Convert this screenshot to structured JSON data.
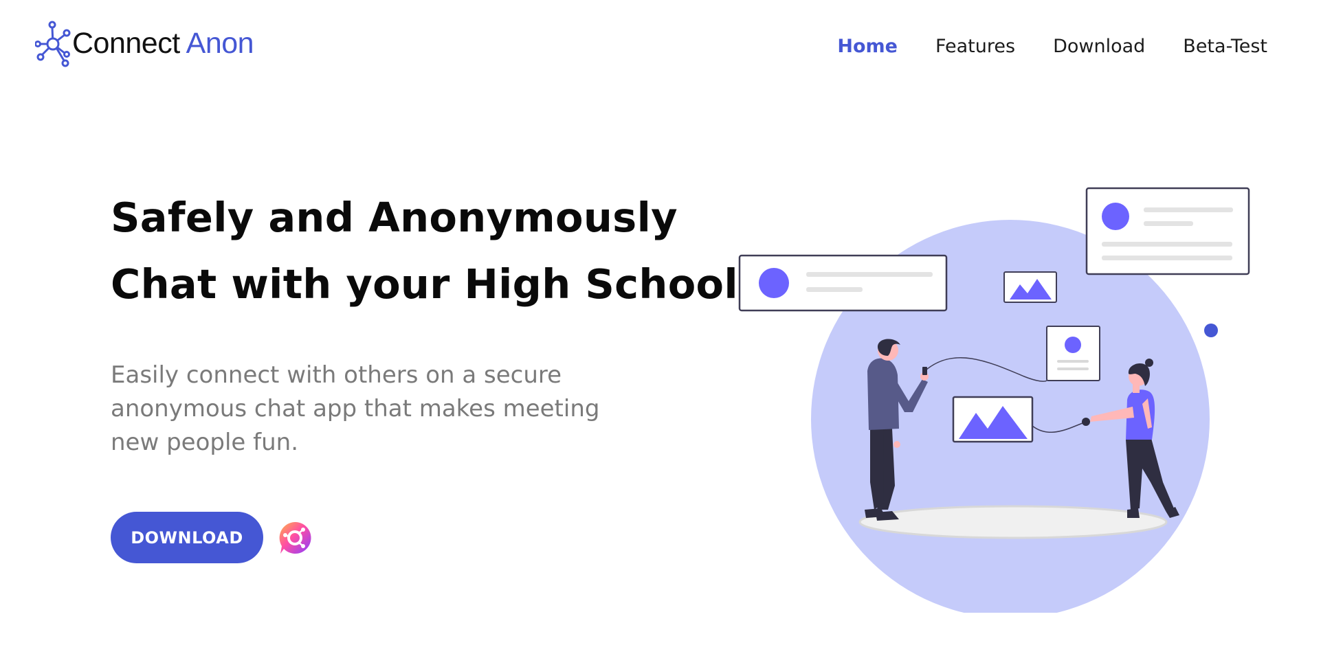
{
  "header": {
    "logo": {
      "text_part1": "Connect",
      "text_part2": "Anon",
      "icon": "network-nodes-icon"
    },
    "nav": [
      {
        "label": "Home",
        "active": true
      },
      {
        "label": "Features",
        "active": false
      },
      {
        "label": "Download",
        "active": false
      },
      {
        "label": "Beta-Test",
        "active": false
      }
    ]
  },
  "hero": {
    "headline_line1": "Safely and Anonymously",
    "headline_line2": "Chat with your High School",
    "subtext": "Easily connect with others on a secure anonymous chat app that makes meeting new people fun.",
    "download_button": "DOWNLOAD",
    "app_icon": "app-logo-icon"
  },
  "illustration": {
    "subject": "two-people-connecting-illustration",
    "icons": [
      "profile-card-icon",
      "image-card-icon",
      "image-frame-icon",
      "contact-card-icon"
    ]
  },
  "colors": {
    "accent": "#4557d4",
    "illustration_circle": "#c5cbfa",
    "illustration_purple": "#6c63ff",
    "text_dark": "#0a0a0a",
    "text_muted": "#7a7a7a"
  }
}
